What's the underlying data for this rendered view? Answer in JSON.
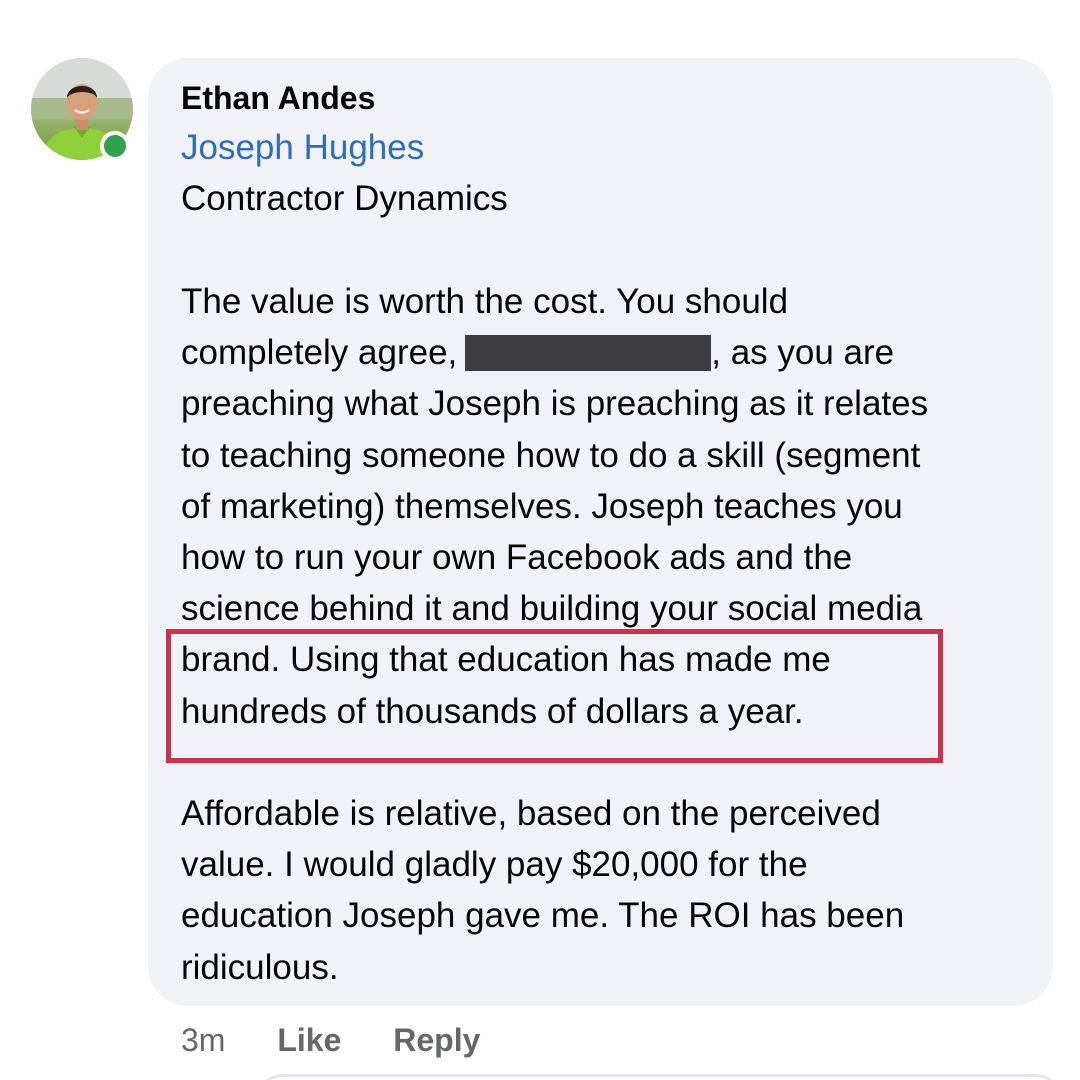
{
  "comment": {
    "author": "Ethan Andes",
    "tagged_user": "Joseph Hughes",
    "company": "Contractor Dynamics",
    "paragraph1": {
      "line1": "The value is worth the cost. You should",
      "line2_before": "completely agree,",
      "line2_after": ", as you are",
      "line3": "preaching what Joseph is preaching as it relates",
      "line4": "to teaching someone how to do a skill (segment",
      "line5": "of marketing) themselves. Joseph teaches you",
      "line6": "how to run your own Facebook ads and the",
      "line7": "science behind it and building your social media",
      "line8": "brand. Using that education has made me",
      "line9": "hundreds of thousands of dollars a year."
    },
    "paragraph2": {
      "line1": "Affordable is relative, based on the perceived",
      "line2": "value. I would gladly pay $20,000 for the",
      "line3": "education Joseph gave me. The ROI has been",
      "line4": "ridiculous."
    },
    "online_status_color": "#31a24c",
    "highlight_color": "#c8324f"
  },
  "actions": {
    "time": "3m",
    "like_label": "Like",
    "reply_label": "Reply"
  }
}
